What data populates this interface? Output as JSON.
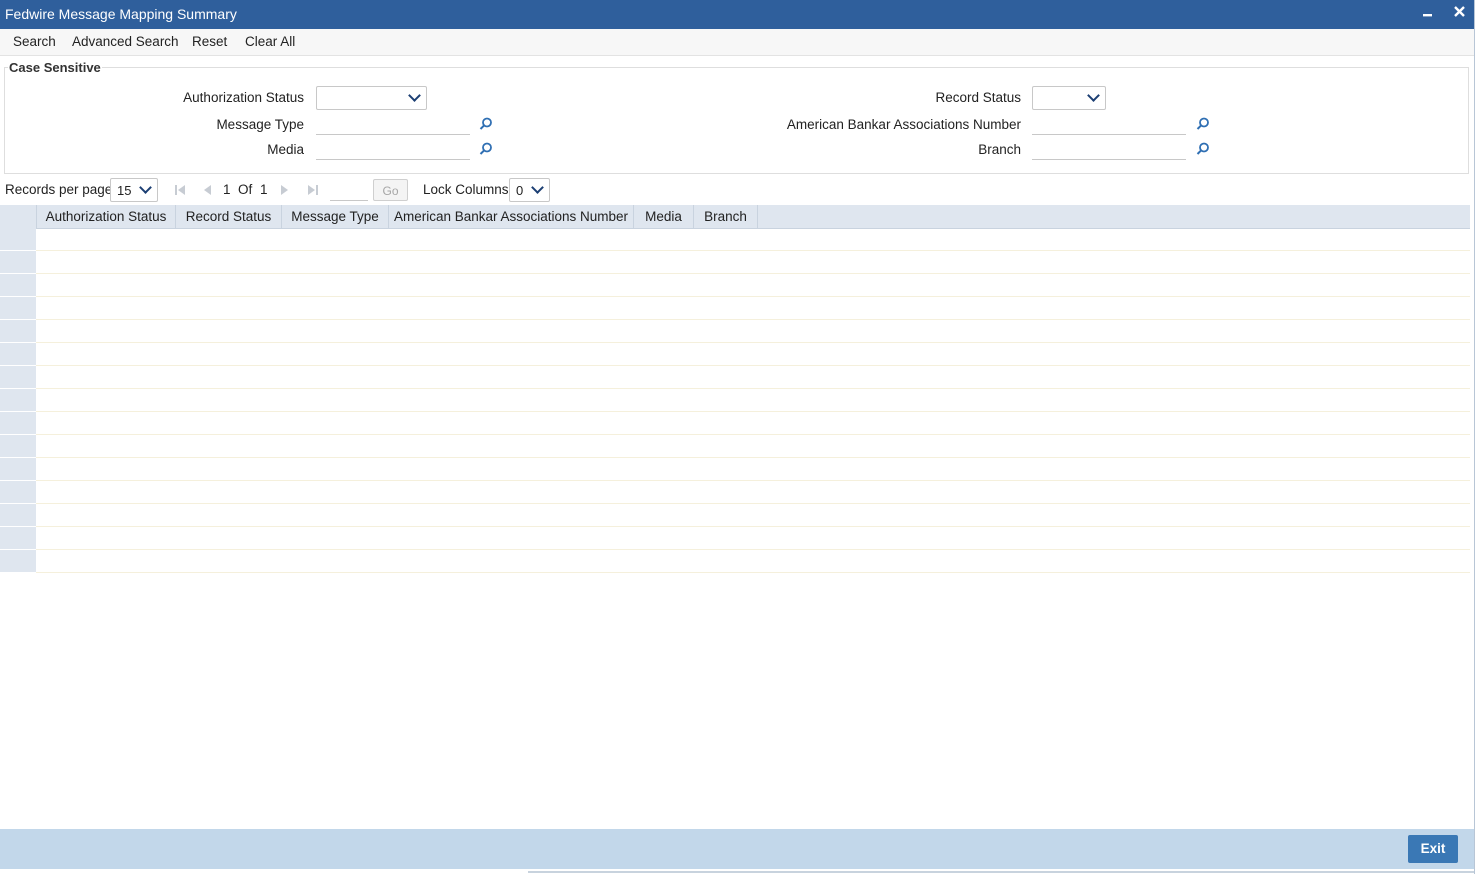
{
  "window": {
    "title": "Fedwire Message Mapping Summary",
    "minimize_icon": "minimize-icon",
    "close_icon": "close-icon"
  },
  "toolbar": {
    "search": "Search",
    "advanced_search": "Advanced Search",
    "reset": "Reset",
    "clear_all": "Clear All"
  },
  "criteria": {
    "legend": "Case Sensitive",
    "authorization_status_label": "Authorization Status",
    "authorization_status_value": "",
    "record_status_label": "Record Status",
    "record_status_value": "",
    "message_type_label": "Message Type",
    "message_type_value": "",
    "aba_number_label": "American Bankar Associations Number",
    "aba_number_value": "",
    "media_label": "Media",
    "media_value": "",
    "branch_label": "Branch",
    "branch_value": ""
  },
  "pager": {
    "records_per_page_label": "Records per page",
    "records_per_page": "15",
    "current_page": "1",
    "of_label": "Of",
    "total_pages": "1",
    "go_label": "Go",
    "lock_columns_label": "Lock Columns",
    "lock_columns": "0"
  },
  "grid": {
    "columns": [
      "Authorization Status",
      "Record Status",
      "Message Type",
      "American Bankar Associations Number",
      "Media",
      "Branch"
    ],
    "empty_rows": 15
  },
  "footer": {
    "exit": "Exit"
  },
  "colors": {
    "titlebar": "#2f5f9c",
    "footer": "#c2d7ea",
    "exit_button": "#3a78b5",
    "grid_header": "#dfe6ef"
  }
}
